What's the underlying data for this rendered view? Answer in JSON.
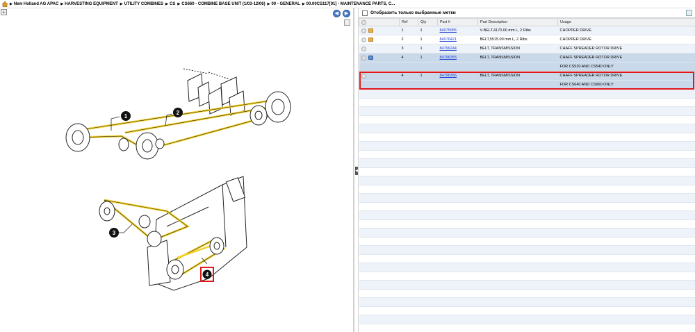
{
  "breadcrumb": [
    "New Holland AG APAC",
    "HARVESTING EQUIPMENT",
    "UTILITY COMBINES",
    "CS",
    "CS660 - COMBINE BASE UNIT (1/03-12/06)",
    "00 - GENERAL",
    "00.00CS117[01] - MAINTENANCE PARTS, C..."
  ],
  "filter": {
    "label": "Отобразить только выбранные метки"
  },
  "table": {
    "headers": [
      "",
      "Ref",
      "Qty",
      "Part #",
      "Part Description",
      "Usage"
    ],
    "rows": [
      {
        "icon": "box-icon",
        "ref": "1",
        "qty": "1",
        "part": "84075955",
        "desc": "V-BELT,4170.00 mm L, 2 Ribs",
        "usage": "CHOPPER DRIVE",
        "style": "odd"
      },
      {
        "icon": "box-icon",
        "ref": "2",
        "qty": "1",
        "part": "84076421",
        "desc": "BELT,5515.00 mm L, 2 Ribs",
        "usage": "CHOPPER DRIVE",
        "style": "even"
      },
      {
        "icon": "",
        "ref": "3",
        "qty": "1",
        "part": "84796244",
        "desc": "BELT, TRANSMISSION",
        "usage": "CHAFF SPREADER ROTOR DRIVE",
        "style": "odd"
      },
      {
        "icon": "note-icon",
        "ref": "4",
        "qty": "1",
        "part": "84796355",
        "desc": "BELT, TRANSMISSION",
        "usage": "CHAFF SPREADER ROTOR DRIVE",
        "style": "sel"
      },
      {
        "icon": "",
        "ref": "",
        "qty": "",
        "part": "",
        "desc": "",
        "usage": "FOR CS520 AND CS540 ONLY",
        "style": "sel"
      },
      {
        "icon": "",
        "ref": "4",
        "qty": "1",
        "part": "84796356",
        "desc": "BELT, TRANSMISSION",
        "usage": "CHAFF SPREADER ROTOR DRIVE",
        "style": "sel"
      },
      {
        "icon": "",
        "ref": "",
        "qty": "",
        "part": "",
        "desc": "",
        "usage": "FOR CS640 AND CS660 ONLY",
        "style": "sel"
      }
    ]
  },
  "callouts": [
    "1",
    "2",
    "3",
    "4"
  ],
  "colors": {
    "belt": "#f2d02a",
    "selected_row": "#c9d9ea",
    "highlight": "#e01818",
    "link": "#1a3fcf"
  }
}
